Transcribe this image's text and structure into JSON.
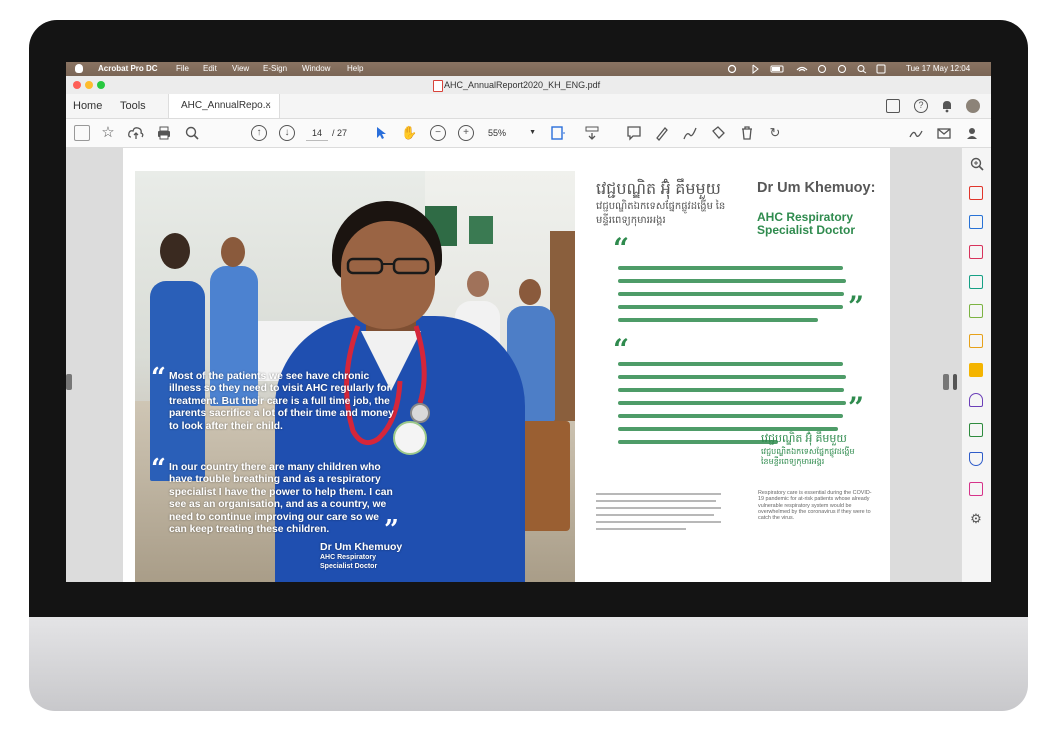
{
  "menubar": {
    "app": "Acrobat Pro DC",
    "menus": [
      "File",
      "Edit",
      "View",
      "E-Sign",
      "Window",
      "Help"
    ],
    "clock": "Tue 17 May  12:04"
  },
  "window": {
    "title": "AHC_AnnualReport2020_KH_ENG.pdf"
  },
  "tabs": {
    "home": "Home",
    "tools": "Tools",
    "document": "AHC_AnnualRepo...",
    "close": "×"
  },
  "toolbar": {
    "current_page": "14",
    "page_total": "/ 27",
    "zoom": "55%"
  },
  "left_page": {
    "quote1": "Most of the patients we see have chronic illness so they need to visit AHC regularly for treatment. But their care is a full time job, the parents sacrifice a lot of their time and money to look after their child.",
    "quote2": "In our country there are many children who have trouble breathing and as a respiratory specialist I have the power to help them. I can see as an organisation, and as a country, we need to continue improving our care so we can keep treating these children.",
    "sig_name": "Dr Um Khemuoy",
    "sig_role_1": "AHC Respiratory",
    "sig_role_2": "Specialist Doctor"
  },
  "right_page": {
    "kh_name": "វេជ្ជបណ្ឌិត អ៊ុំ គឹមមួយ",
    "kh_subtitle": "វេជ្ជបណ្ឌិតឯកទេសផ្នែកផ្លូវដង្ហើម នៃមន្ទីរពេទ្យកុមារអង្គរ",
    "en_name": "Dr Um Khemuoy:",
    "en_role": "AHC Respiratory Specialist Doctor",
    "kh_sig_name": "វេជ្ជបណ្ឌិត អ៊ុំ គឹមមួយ",
    "kh_sig_role": "វេជ្ជបណ្ឌិតឯកទេសផ្នែកផ្លូវដង្ហើម នៃមន្ទីរពេទ្យកុមារអង្គរ",
    "footnote_en": "Respiratory care is essential during the COVID-19 pandemic for at-risk patients whose already vulnerable respiratory system would be overwhelmed by the coronavirus if they were to catch the virus."
  },
  "colors": {
    "accent_green": "#2f8b4e",
    "scrub_blue": "#1f4fb0"
  },
  "icons": {
    "toolbar": [
      "save-icon",
      "bookmark-star-icon",
      "upload-cloud-icon",
      "print-icon",
      "zoom-search-icon",
      "page-up-icon",
      "page-down-icon",
      "select-cursor-icon",
      "hand-icon",
      "zoom-out-icon",
      "zoom-in-icon",
      "fit-page-icon",
      "scroll-mode-icon",
      "comment-icon",
      "highlight-pen-icon",
      "draw-icon",
      "stamp-icon",
      "trash-icon",
      "rotate-icon",
      "sign-icon",
      "email-icon",
      "share-icon"
    ],
    "right_panel": [
      "zoom-panel-icon",
      "export-pdf-icon",
      "edit-pdf-icon",
      "organize-pages-icon",
      "create-pdf-icon",
      "compress-icon",
      "comment-tool-icon",
      "fill-sign-icon",
      "print-production-icon",
      "protect-icon",
      "pdf-standards-icon",
      "more-tools-icon"
    ]
  }
}
